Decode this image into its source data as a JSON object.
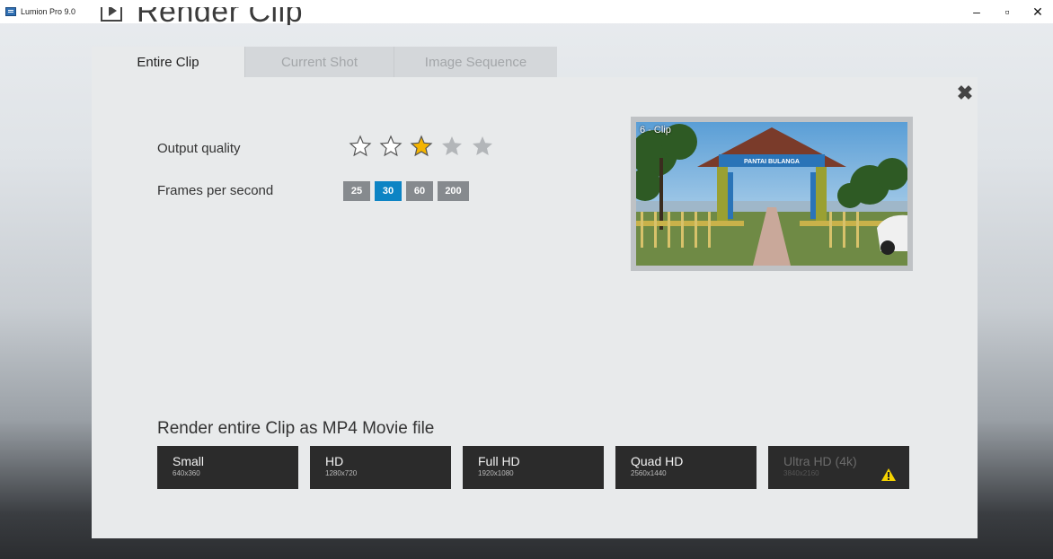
{
  "window": {
    "title": "Lumion Pro 9.0",
    "controls": {
      "minimize": "–",
      "maximize": "▫",
      "close": "✕"
    }
  },
  "heading": {
    "title": "Render Clip"
  },
  "tabs": [
    {
      "label": "Entire Clip",
      "active": true
    },
    {
      "label": "Current Shot",
      "active": false
    },
    {
      "label": "Image Sequence",
      "active": false
    }
  ],
  "settings": {
    "quality_label": "Output quality",
    "quality_rating": 3,
    "quality_max": 5,
    "fps_label": "Frames per second",
    "fps_options": [
      "25",
      "30",
      "60",
      "200"
    ],
    "fps_selected": "30"
  },
  "preview": {
    "label": "6 - Clip",
    "gate_sign": "PANTAI BULANGA"
  },
  "render": {
    "heading": "Render entire Clip as MP4 Movie file",
    "options": [
      {
        "name": "Small",
        "dims": "640x360",
        "enabled": true
      },
      {
        "name": "HD",
        "dims": "1280x720",
        "enabled": true
      },
      {
        "name": "Full HD",
        "dims": "1920x1080",
        "enabled": true
      },
      {
        "name": "Quad HD",
        "dims": "2560x1440",
        "enabled": true
      },
      {
        "name": "Ultra HD (4k)",
        "dims": "3840x2160",
        "enabled": false,
        "warning": true
      }
    ]
  },
  "colors": {
    "accent": "#0d84c4",
    "star_active": "#f4b400",
    "warning": "#f5d300"
  },
  "icons": [
    "app-icon",
    "play-icon",
    "close-icon",
    "star-icon",
    "warning-icon"
  ]
}
